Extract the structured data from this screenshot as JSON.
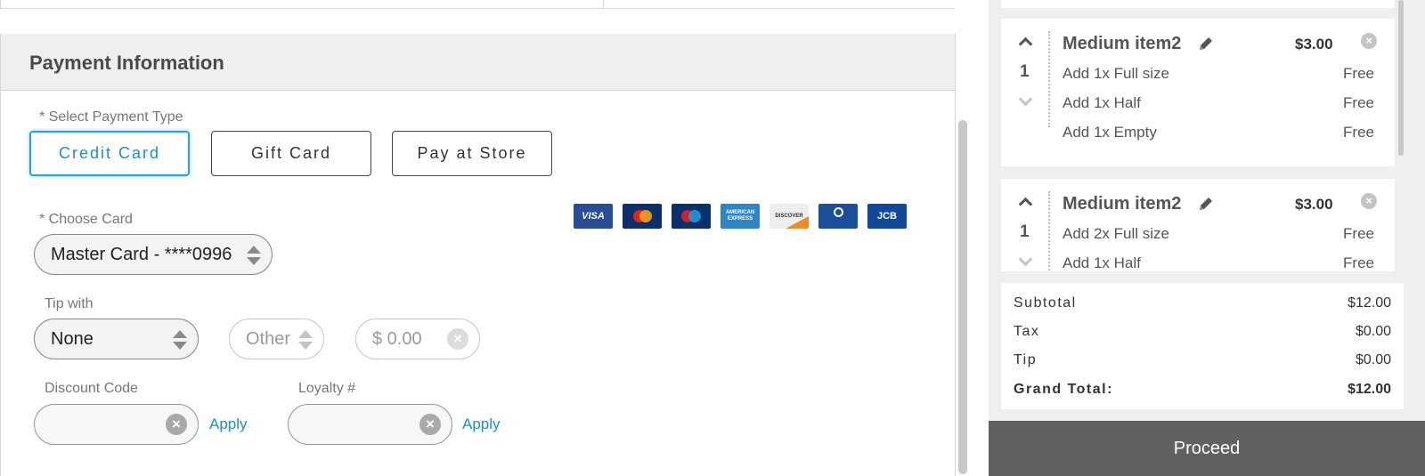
{
  "payment": {
    "section_title": "Payment Information",
    "select_type_label": "* Select Payment Type",
    "types": [
      "Credit Card",
      "Gift Card",
      "Pay at Store"
    ],
    "selected_type": "Credit Card",
    "choose_card_label": "* Choose Card",
    "card_value": "Master Card - ****0996",
    "accepted_cards": [
      "VISA",
      "MasterCard",
      "Maestro",
      "AMERICAN EXPRESS",
      "DISCOVER",
      "Diners Club",
      "JCB"
    ],
    "tip_label": "Tip with",
    "tip_value": "None",
    "tip_other": "Other",
    "tip_amount": "$ 0.00",
    "discount_label": "Discount Code",
    "loyalty_label": "Loyalty #",
    "apply_label": "Apply"
  },
  "cart": {
    "items": [
      {
        "qty": "1",
        "name": "Medium item2",
        "price": "$3.00",
        "modifiers": [
          {
            "label": "Add 1x Full size",
            "price": "Free"
          },
          {
            "label": "Add 1x Half",
            "price": "Free"
          },
          {
            "label": "Add 1x Empty",
            "price": "Free"
          }
        ]
      },
      {
        "qty": "1",
        "name": "Medium item2",
        "price": "$3.00",
        "modifiers": [
          {
            "label": "Add 2x Full size",
            "price": "Free"
          },
          {
            "label": "Add 1x Half",
            "price": "Free"
          }
        ]
      }
    ]
  },
  "totals": {
    "subtotal_label": "Subtotal",
    "subtotal": "$12.00",
    "tax_label": "Tax",
    "tax": "$0.00",
    "tip_label": "Tip",
    "tip": "$0.00",
    "grand_label": "Grand Total:",
    "grand": "$12.00"
  },
  "proceed_label": "Proceed",
  "colors": {
    "accent": "#1b8fc0",
    "proceed_bg": "#616161",
    "panel_bg": "#efefef"
  }
}
